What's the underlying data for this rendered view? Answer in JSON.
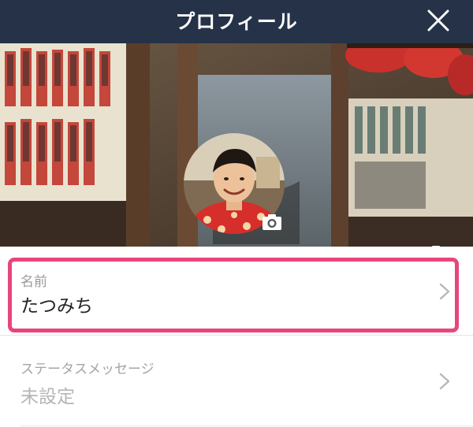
{
  "header": {
    "title": "プロフィール"
  },
  "icons": {
    "close": "close-icon",
    "camera": "camera-icon",
    "chevron": "chevron-right-icon"
  },
  "fields": [
    {
      "label": "名前",
      "value": "たつみち"
    },
    {
      "label": "ステータスメッセージ",
      "value": "未設定"
    }
  ],
  "colors": {
    "header_bg": "#253248",
    "highlight": "#e8467a",
    "placeholder_text": "#b6b6b6"
  }
}
